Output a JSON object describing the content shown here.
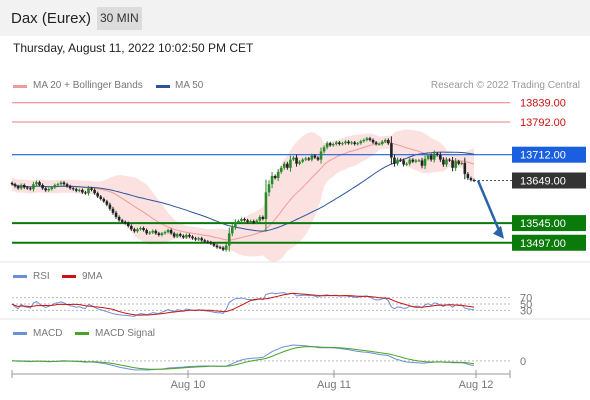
{
  "header": {
    "title": "Dax (Eurex)",
    "timeframe": "30 MIN"
  },
  "timestamp": "Thursday, August 11, 2022 10:02:50 PM CET",
  "legend": {
    "ma20": "MA 20 + Bollinger Bands",
    "ma50": "MA 50",
    "copyright": "Research © 2022 Trading Central",
    "rsi": "RSI",
    "rsi_ma": "9MA",
    "macd": "MACD",
    "macd_signal": "MACD Signal"
  },
  "colors": {
    "resistance": "#e8474f",
    "ma50": "#2a5599",
    "pivot": "#1a5fe0",
    "support": "#0a7a0a",
    "last": "#333333",
    "up": "#2a8a2a",
    "down": "#222222",
    "band": "#fcdcdc",
    "ma20": "#f29a9a",
    "rsi": "#6a8fd8",
    "rsi_ma": "#cc1111",
    "macd": "#6a8fd8",
    "macd_signal": "#4aa324",
    "arrow": "#2a63a8"
  },
  "chart_data": [
    {
      "type": "candlestick",
      "levels": [
        {
          "value": 13839.0,
          "label": "13839.00",
          "kind": "resistance"
        },
        {
          "value": 13792.0,
          "label": "13792.00",
          "kind": "resistance"
        },
        {
          "value": 13712.0,
          "label": "13712.00",
          "kind": "pivot"
        },
        {
          "value": 13649.0,
          "label": "13649.00",
          "kind": "last"
        },
        {
          "value": 13545.0,
          "label": "13545.00",
          "kind": "support"
        },
        {
          "value": 13497.0,
          "label": "13497.00",
          "kind": "support"
        }
      ],
      "ylim": [
        13450,
        13870
      ],
      "closes": [
        13640,
        13635,
        13630,
        13638,
        13632,
        13630,
        13628,
        13640,
        13645,
        13638,
        13630,
        13625,
        13628,
        13632,
        13638,
        13640,
        13644,
        13640,
        13635,
        13630,
        13628,
        13624,
        13626,
        13620,
        13618,
        13630,
        13626,
        13618,
        13610,
        13604,
        13598,
        13590,
        13580,
        13570,
        13560,
        13552,
        13548,
        13545,
        13538,
        13530,
        13525,
        13530,
        13533,
        13528,
        13520,
        13522,
        13526,
        13520,
        13516,
        13520,
        13523,
        13528,
        13520,
        13512,
        13518,
        13514,
        13510,
        13516,
        13512,
        13508,
        13505,
        13508,
        13503,
        13500,
        13498,
        13495,
        13490,
        13486,
        13485,
        13480,
        13490,
        13520,
        13535,
        13548,
        13550,
        13555,
        13552,
        13548,
        13550,
        13546,
        13551,
        13560,
        13555,
        13620,
        13640,
        13660,
        13655,
        13670,
        13680,
        13690,
        13680,
        13700,
        13705,
        13690,
        13695,
        13700,
        13703,
        13700,
        13710,
        13705,
        13700,
        13720,
        13730,
        13740,
        13735,
        13738,
        13742,
        13738,
        13740,
        13744,
        13740,
        13742,
        13738,
        13740,
        13745,
        13748,
        13752,
        13748,
        13742,
        13738,
        13738,
        13744,
        13748,
        13740,
        13705,
        13690,
        13700,
        13698,
        13688,
        13690,
        13700,
        13695,
        13698,
        13698,
        13685,
        13702,
        13710,
        13700,
        13715,
        13712,
        13700,
        13688,
        13700,
        13698,
        13680,
        13696,
        13690,
        13692,
        13665,
        13655,
        13650,
        13649
      ],
      "indicators": {
        "ma20": "MA 20",
        "bollinger": "Bollinger Bands",
        "ma50": "MA 50"
      }
    },
    {
      "type": "line",
      "name": "RSI",
      "levels": [
        70,
        50,
        30
      ],
      "level_labels": [
        "70",
        "50",
        "30"
      ]
    },
    {
      "type": "line",
      "name": "MACD",
      "level": 0,
      "level_label": "0",
      "x_labels": [
        "Aug 10",
        "Aug 11",
        "Aug 12"
      ]
    }
  ]
}
